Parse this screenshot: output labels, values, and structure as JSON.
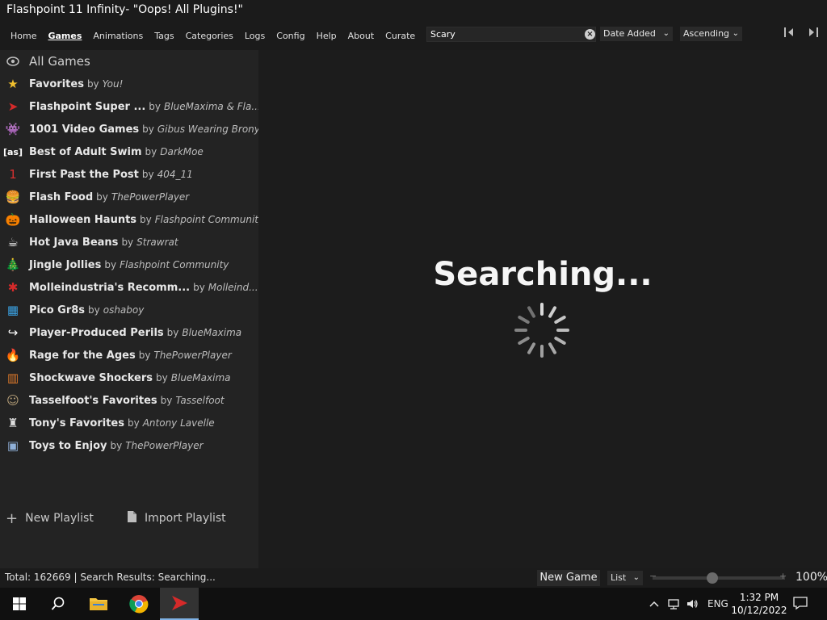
{
  "window": {
    "title": "Flashpoint 11 Infinity- \"Oops! All Plugins!\""
  },
  "nav": {
    "items": [
      {
        "label": "Home"
      },
      {
        "label": "Games",
        "active": true
      },
      {
        "label": "Animations"
      },
      {
        "label": "Tags"
      },
      {
        "label": "Categories"
      },
      {
        "label": "Logs"
      },
      {
        "label": "Config"
      },
      {
        "label": "Help"
      },
      {
        "label": "About"
      },
      {
        "label": "Curate"
      }
    ]
  },
  "search": {
    "value": "Scary",
    "clear_icon": "clear-icon"
  },
  "sort": {
    "selected": "Date Added"
  },
  "order": {
    "selected": "Ascending"
  },
  "sidebar": {
    "all_games": "All Games",
    "by_word": "by",
    "playlists": [
      {
        "title": "Favorites",
        "author": "You!",
        "icon": "star-icon",
        "glyph": "★",
        "color": "#f2c12e"
      },
      {
        "title": "Flashpoint Super ...",
        "author": "BlueMaxima & Fla...",
        "icon": "flashpoint-logo-icon",
        "glyph": "➤",
        "color": "#d62a2a"
      },
      {
        "title": "1001 Video Games",
        "author": "Gibus Wearing Brony",
        "icon": "space-invader-icon",
        "glyph": "👾",
        "color": "#ffffff"
      },
      {
        "title": "Best of Adult Swim",
        "author": "DarkMoe",
        "icon": "adult-swim-icon",
        "glyph": "[as]",
        "color": "#ffffff"
      },
      {
        "title": "First Past the Post",
        "author": "404_11",
        "icon": "number-one-icon",
        "glyph": "1",
        "color": "#d83030"
      },
      {
        "title": "Flash Food",
        "author": "ThePowerPlayer",
        "icon": "burger-icon",
        "glyph": "🍔",
        "color": "#e2a34a"
      },
      {
        "title": "Halloween Haunts",
        "author": "Flashpoint Community",
        "icon": "pumpkin-icon",
        "glyph": "🎃",
        "color": "#f07b1a"
      },
      {
        "title": "Hot Java Beans",
        "author": "Strawrat",
        "icon": "coffee-cup-icon",
        "glyph": "☕",
        "color": "#ffffff"
      },
      {
        "title": "Jingle Jollies",
        "author": "Flashpoint Community",
        "icon": "christmas-tree-icon",
        "glyph": "🎄",
        "color": "#3cb44b"
      },
      {
        "title": "Molleindustria's Recomm...",
        "author": "Molleind...",
        "icon": "molleindustria-icon",
        "glyph": "✱",
        "color": "#d62a2a"
      },
      {
        "title": "Pico Gr8s",
        "author": "oshaboy",
        "icon": "pico-blocks-icon",
        "glyph": "▦",
        "color": "#3aa0e0"
      },
      {
        "title": "Player-Produced Perils",
        "author": "BlueMaxima",
        "icon": "share-arrow-icon",
        "glyph": "↪",
        "color": "#ffffff"
      },
      {
        "title": "Rage for the Ages",
        "author": "ThePowerPlayer",
        "icon": "fire-icon",
        "glyph": "🔥",
        "color": "#f06a1a"
      },
      {
        "title": "Shockwave Shockers",
        "author": "BlueMaxima",
        "icon": "shockwave-icon",
        "glyph": "▥",
        "color": "#e07a2a"
      },
      {
        "title": "Tasselfoot's Favorites",
        "author": "Tasselfoot",
        "icon": "tasselfoot-avatar-icon",
        "glyph": "☺",
        "color": "#b9a27a"
      },
      {
        "title": "Tony's Favorites",
        "author": "Antony Lavelle",
        "icon": "person-silhouette-icon",
        "glyph": "♜",
        "color": "#dddddd"
      },
      {
        "title": "Toys to Enjoy",
        "author": "ThePowerPlayer",
        "icon": "toy-blocks-icon",
        "glyph": "▣",
        "color": "#8fb0d8"
      }
    ],
    "new_playlist": "New Playlist",
    "import_playlist": "Import Playlist"
  },
  "main": {
    "searching_text": "Searching..."
  },
  "status": {
    "text": "Total: 162669 | Search Results: Searching...",
    "new_game": "New Game",
    "layout": "List",
    "scale_min": "−",
    "scale_max": "+",
    "scale_percent": "100%",
    "scale_level": 0.45
  },
  "taskbar": {
    "lang": "ENG",
    "time": "1:32 PM",
    "date": "10/12/2022"
  }
}
